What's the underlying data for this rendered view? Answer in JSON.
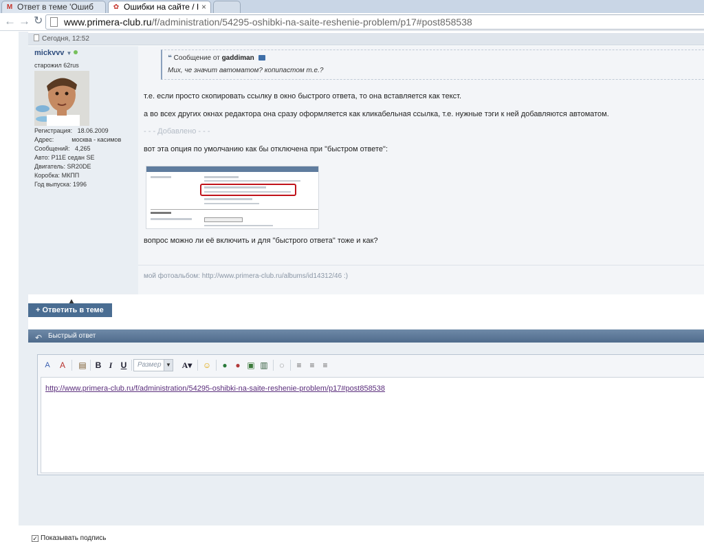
{
  "browser": {
    "tabs": [
      {
        "favicon": "M",
        "title": "Ответ в теме 'Ошиб"
      },
      {
        "favicon": "✿",
        "title": "Ошибки на сайте / I"
      },
      {
        "title": ""
      }
    ],
    "tab_close": "×",
    "url_domain": "www.primera-club.ru",
    "url_path": "/f/administration/54295-oshibki-na-saite-reshenie-problem/p17#post858538"
  },
  "post": {
    "date": "Сегодня, 12:52",
    "username": "mickvvv",
    "user_title": "старожил 62rus",
    "stats": [
      {
        "label": "Регистрация:",
        "value": "18.06.2009"
      },
      {
        "label": "Адрес:",
        "value": "москва - касимов"
      },
      {
        "label": "Сообщений:",
        "value": "4,265"
      },
      {
        "label": "Авто:",
        "value": "P11E седан SE"
      },
      {
        "label": "Двигатель:",
        "value": "SR20DE"
      },
      {
        "label": "Коробка:",
        "value": "МКПП"
      },
      {
        "label": "Год выпуска:",
        "value": "1996"
      }
    ],
    "quote": {
      "header_prefix": "Сообщение от",
      "author": "gaddiman",
      "text": "Мих, че значит автоматом? копипастом т.е.?"
    },
    "paragraphs": [
      "т.е. если просто скопировать ссылку в окно быстрого ответа, то она вставляется как текст.",
      "а во всех других окнах редактора она сразу оформляется как кликабельная ссылка, т.е. нужные тэги к ней добавляются автоматом.",
      "- - - Добавлено - - -",
      "вот эта опция по умолчанию как бы отключена при \"быстром ответе\":",
      "вопрос можно ли её включить и для \"быстрого ответа\" тоже и как?"
    ],
    "signature": "мой фотоальбом: http://www.primera-club.ru/albums/id14312/46 :)"
  },
  "reply_button": "+ Ответить в теме",
  "quick_reply": {
    "title": "Быстрый ответ",
    "size_select": "Размер",
    "text": "http://www.primera-club.ru/f/administration/54295-oshibki-na-saite-reshenie-problem/p17#post858538",
    "show_signature": "Показывать подпись"
  }
}
